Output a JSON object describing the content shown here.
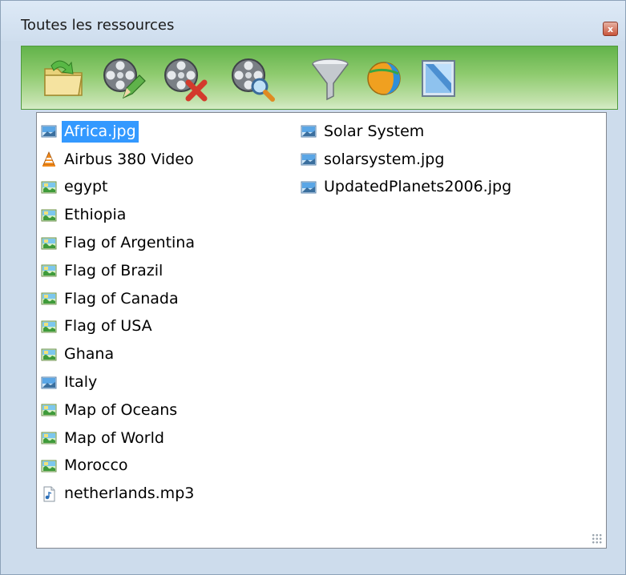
{
  "window": {
    "title": "Toutes les ressources",
    "close_label": "x"
  },
  "toolbar": {
    "buttons": [
      {
        "name": "open-folder-icon"
      },
      {
        "name": "edit-media-icon"
      },
      {
        "name": "delete-media-icon"
      },
      {
        "name": "search-media-icon"
      },
      {
        "name": "filter-icon"
      },
      {
        "name": "web-resource-icon"
      },
      {
        "name": "image-window-icon"
      }
    ]
  },
  "resources": {
    "column1": [
      {
        "label": "Africa.jpg",
        "icon": "picture-icon",
        "selected": true
      },
      {
        "label": "Airbus 380 Video",
        "icon": "vlc-cone-icon"
      },
      {
        "label": "egypt",
        "icon": "map-picture-icon"
      },
      {
        "label": "Ethiopia",
        "icon": "map-picture-icon"
      },
      {
        "label": "Flag of Argentina",
        "icon": "map-picture-icon"
      },
      {
        "label": "Flag of Brazil",
        "icon": "map-picture-icon"
      },
      {
        "label": "Flag of Canada",
        "icon": "map-picture-icon"
      },
      {
        "label": "Flag of USA",
        "icon": "map-picture-icon"
      },
      {
        "label": "Ghana",
        "icon": "map-picture-icon"
      },
      {
        "label": "Italy",
        "icon": "picture-icon"
      },
      {
        "label": "Map of Oceans",
        "icon": "map-picture-icon"
      },
      {
        "label": "Map of World",
        "icon": "map-picture-icon"
      },
      {
        "label": "Morocco",
        "icon": "map-picture-icon"
      },
      {
        "label": "netherlands.mp3",
        "icon": "audio-file-icon"
      }
    ],
    "column2": [
      {
        "label": "Solar System",
        "icon": "picture-icon"
      },
      {
        "label": "solarsystem.jpg",
        "icon": "picture-icon"
      },
      {
        "label": "UpdatedPlanets2006.jpg",
        "icon": "picture-icon"
      }
    ]
  },
  "colors": {
    "toolbar_green": "#8fcb6f",
    "selection": "#3399ff"
  }
}
